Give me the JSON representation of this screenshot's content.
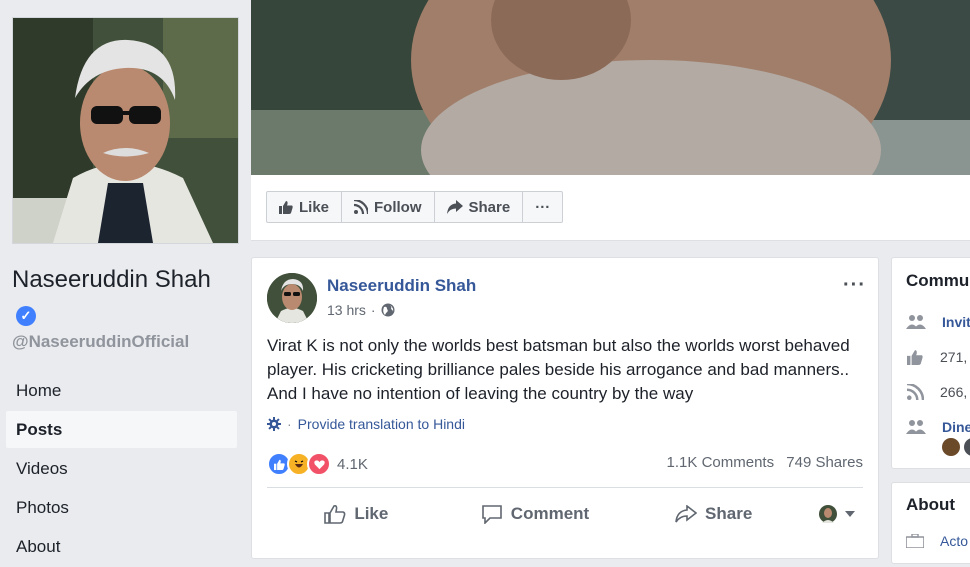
{
  "profile": {
    "name": "Naseeruddin Shah",
    "handle": "@NaseeruddinOfficial",
    "verified_mark": "✓"
  },
  "nav": {
    "items": [
      {
        "label": "Home",
        "active": false
      },
      {
        "label": "Posts",
        "active": true
      },
      {
        "label": "Videos",
        "active": false
      },
      {
        "label": "Photos",
        "active": false
      },
      {
        "label": "About",
        "active": false
      }
    ]
  },
  "actions": {
    "like": "Like",
    "follow": "Follow",
    "share": "Share",
    "more": "···"
  },
  "post": {
    "author": "Naseeruddin Shah",
    "time": "13 hrs",
    "dot": "·",
    "privacy_icon": "globe-icon",
    "text": "Virat K is not only the worlds best batsman but also the worlds worst behaved player. His cricketing brilliance pales beside his arrogance and bad manners.. And I have no intention of leaving the country by the way",
    "translate": "Provide translation to Hindi",
    "reaction_count": "4.1K",
    "comments": "1.1K Comments",
    "shares": "749 Shares",
    "like_label": "Like",
    "comment_label": "Comment",
    "share_label": "Share",
    "more": "···"
  },
  "community": {
    "title": "Commu",
    "rows": [
      "Invit",
      "271,",
      "266,",
      "Dine"
    ]
  },
  "about": {
    "title": "About",
    "row": "Acto"
  },
  "colors": {
    "link": "#365899",
    "like_blue": "#4080ff",
    "love_red": "#f25268",
    "haha_yellow": "#f7b125"
  }
}
